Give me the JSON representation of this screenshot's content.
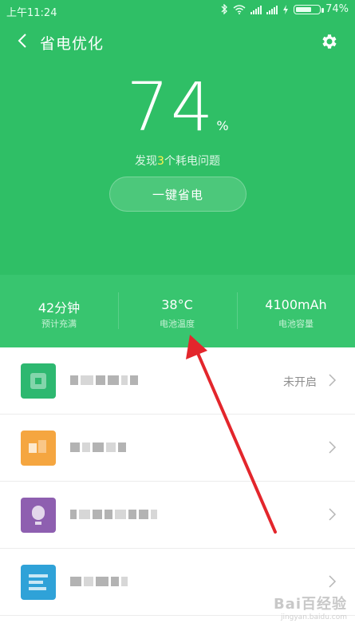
{
  "status_bar": {
    "time": "上午11:24",
    "battery_text": "74%",
    "battery_level": 0.74
  },
  "header": {
    "title": "省电优化"
  },
  "summary": {
    "percent": "74",
    "percent_unit": "%",
    "issues_prefix": "发现",
    "issues_count": "3",
    "issues_suffix": "个耗电问题",
    "optimize_button": "一键省电"
  },
  "stats": [
    {
      "value": "42分钟",
      "label": "预计充满"
    },
    {
      "value": "38°C",
      "label": "电池温度"
    },
    {
      "value": "4100mAh",
      "label": "电池容量"
    }
  ],
  "apps": [
    {
      "icon": "green-app-icon",
      "color": "#2db870",
      "status": "未开启"
    },
    {
      "icon": "orange-app-icon",
      "color": "#f5a640",
      "status": ""
    },
    {
      "icon": "purple-app-icon",
      "color": "#8e5fb0",
      "status": ""
    },
    {
      "icon": "blue-app-icon",
      "color": "#2fa2d8",
      "status": ""
    }
  ],
  "colors": {
    "primary_green": "#2fbf66",
    "stats_green": "#38c56f",
    "highlight": "#fff34d",
    "arrow": "#e3262c"
  },
  "watermark": {
    "main": "Bai百经验",
    "sub": "jingyan.baidu.com"
  }
}
